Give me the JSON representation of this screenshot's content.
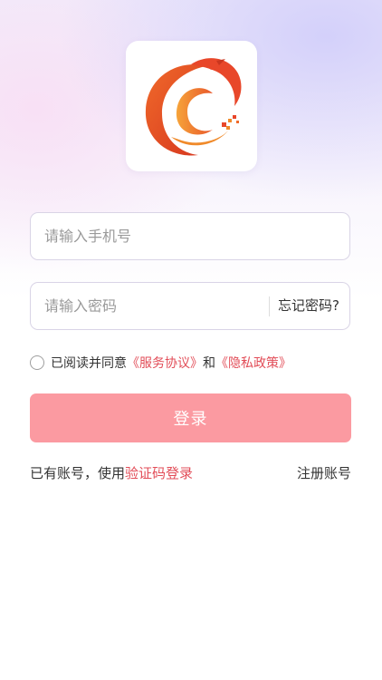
{
  "logo": {
    "icon": "app-logo-icon",
    "colors": [
      "#e8472a",
      "#f08a2a",
      "#c9361f"
    ]
  },
  "form": {
    "phone_placeholder": "请输入手机号",
    "password_placeholder": "请输入密码",
    "forgot_label": "忘记密码?"
  },
  "agreement": {
    "prefix": "已阅读并同意",
    "service_link": "《服务协议》",
    "and": "和",
    "privacy_link": "《隐私政策》",
    "checked": false
  },
  "login_button_label": "登录",
  "footer": {
    "alt_prefix": "已有账号，使用",
    "alt_link": "验证码登录",
    "register_label": "注册账号"
  },
  "colors": {
    "accent": "#e24d58",
    "button": "#fb9aa1"
  }
}
